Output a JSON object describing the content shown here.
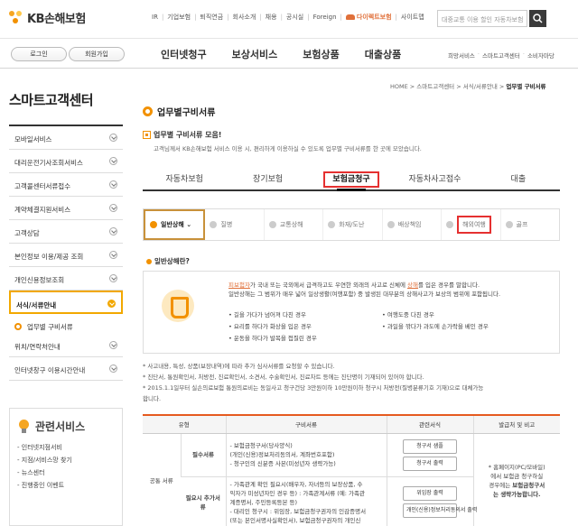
{
  "header": {
    "logo_text": "KB손해보험",
    "util_links": [
      "IR",
      "기업보험",
      "퇴직연금",
      "회사소개",
      "채용",
      "공시실",
      "Foreign"
    ],
    "direct_label": "다이렉트보험",
    "sitemap_label": "사이트맵",
    "search_placeholder": "대중교통 이용 할인 자동차보험"
  },
  "navbar": {
    "login_label": "로그인",
    "join_label": "회원가입",
    "gnb": [
      "인터넷청구",
      "보상서비스",
      "보험상품",
      "대출상품"
    ],
    "sub_links": [
      "희망서비스",
      "스마트고객센터",
      "소비자마당"
    ]
  },
  "lnb": {
    "title": "스마트고객센터",
    "items": [
      "모바일서비스",
      "대리운전기사조회서비스",
      "고객콜센터서류접수",
      "계약체결지원서비스",
      "고객상담",
      "본인정보 이용/제공 조회",
      "개인신용정보조회",
      "서식/서류안내"
    ],
    "sub_item": "업무별 구비서류",
    "items_after": [
      "위치/연락처안내",
      "인터넷창구 이용시간안내"
    ]
  },
  "related": {
    "title": "관련서비스",
    "items": [
      "- 인터넷지점서비",
      "- 지점/서비스망 찾기",
      "- 뉴스센터",
      "- 진행중인 이벤트"
    ]
  },
  "breadcrumb": {
    "path": "HOME > 스마트고객센터 > 서식/서류안내 > ",
    "current": "업무별 구비서류"
  },
  "page": {
    "title": "업무별구비서류",
    "notice_title": "업무별 구비서류 모음!",
    "notice_desc": "고객님께서 KB손해보험 서비스 이용 시, 편리하게 이용하실 수 있도록 업무별 구비서류를 한 곳에 모았습니다."
  },
  "tabs": [
    "자동차보험",
    "장기보험",
    "보험금청구",
    "자동차사고접수",
    "대출"
  ],
  "subtabs": [
    "일반상해",
    "질병",
    "교통상해",
    "화재/도난",
    "배상책임",
    "해외여행",
    "골프"
  ],
  "infobox": {
    "title": "일반상해란?",
    "line1a": "피보험자",
    "line1b": "가 국내 또는 국외에서 급격하고도 우연한 외래의 사고로 신체에 ",
    "line1c": "상해",
    "line1d": "를 입은 경우를 말합니다.",
    "line2": "일반상해는 그 범위가 매우 넓어 일상생활(여행포함) 중 발생된 대부분의 상해사고가 보상의 범위에 포함됩니다.",
    "bullets": [
      "길을 가다가 넘어져 다친 경우",
      "여행도중 다친 경우",
      "요리를 하다가 화상을 입은 경우",
      "과일을 깎다가 과도에 손가락을 베인 경우",
      "운동을 하다가 발목을 접질린 경우"
    ]
  },
  "notes": [
    "* 사고내용, 특성, 상품(보장내역)에 따라 추가 심사서류를 요청할 수 있습니다.",
    "* 진단서, 통원확인서, 처방전, 진료확인서, 소견서, 수술확인서, 진료차트 등에는 진단명이 기재되어 있어야 합니다.",
    "* 2015.1.1일부터 실손의료보험 통원의료비는 동일사고 청구건당 3만원이하 10만원이하 청구시 처방전(질병분류기호 기재)으로 대체가능",
    "  합니다."
  ],
  "table": {
    "headers": [
      "유형",
      "구비서류",
      "관련서식",
      "발급처 및 비고"
    ],
    "group": "공통 서류",
    "rows": [
      {
        "type": "필수서류",
        "docs": [
          "- 보험금청구서(당사양식)",
          "(개인(신용)정보처리동의서, 계좌번호포함)",
          "- 청구인의 신분증 사본(미성년자 생략가능)"
        ],
        "buttons": [
          "청구서 샘플",
          "청구서 출력"
        ]
      },
      {
        "type": "필요시 추가서류",
        "docs": [
          "- 가족관계 확인 필요시(배우자, 자녀등의 보장상품, 수",
          "익자가 미성년자인 경우 등) : 가족관계서류 (예: 가족관",
          "계증명서, 주민등록등본 등)",
          "- 대리인 청구시 : 위임장, 보험금청구권자의 인감증명서",
          "(또는 본인서명사실확인서), 보험금청구권자의 개인신"
        ],
        "buttons": [
          "위임장 출력",
          "개인(신용)정보처리동의서 출력"
        ]
      }
    ],
    "remark": [
      "* 홈페이지(PC/모바일)",
      "에서 보험금 청구하실",
      "경우에는 ",
      "보험금청구서",
      "는 생략가능합니다."
    ]
  }
}
